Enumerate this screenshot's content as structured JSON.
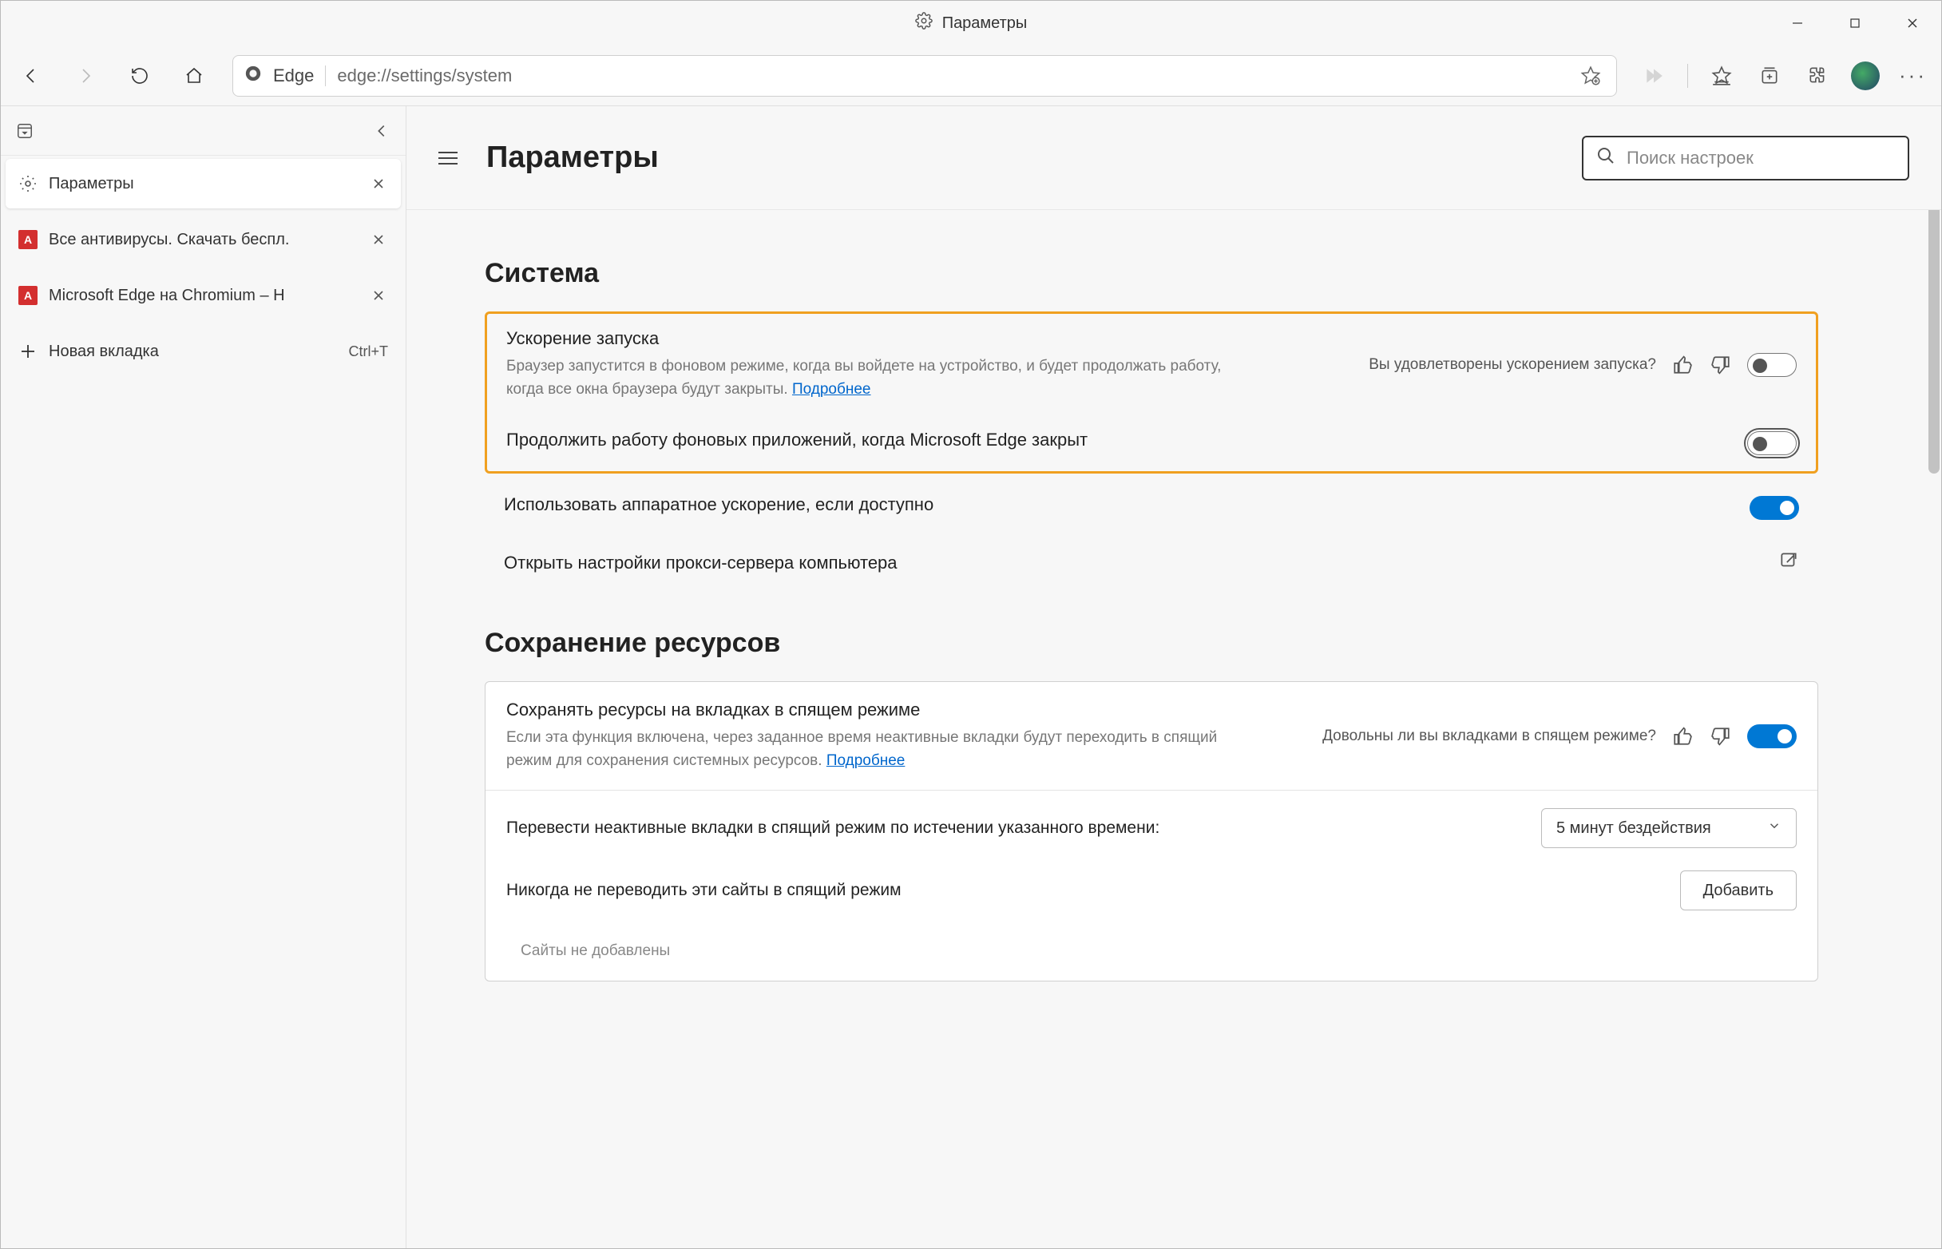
{
  "window": {
    "title": "Параметры"
  },
  "toolbar": {
    "edge_label": "Edge",
    "url": "edge://settings/system"
  },
  "vtabs": {
    "tabs": [
      {
        "label": "Параметры",
        "active": true,
        "close": true
      },
      {
        "label": "Все антивирусы. Скачать беспл.",
        "active": false,
        "close": true
      },
      {
        "label": "Microsoft Edge на Chromium – Н",
        "active": false,
        "close": true
      }
    ],
    "new_tab_label": "Новая вкладка",
    "new_tab_shortcut": "Ctrl+T"
  },
  "settings": {
    "page_title": "Параметры",
    "search_placeholder": "Поиск настроек",
    "section_system": "Система",
    "section_resources": "Сохранение ресурсов",
    "startup_boost": {
      "title": "Ускорение запуска",
      "desc_prefix": "Браузер запустится в фоновом режиме, когда вы войдете на устройство, и будет продолжать работу, когда все окна браузера будут закрыты. ",
      "learn_more": "Подробнее",
      "feedback_q": "Вы удовлетворены ускорением запуска?"
    },
    "bg_apps": {
      "title": "Продолжить работу фоновых приложений, когда Microsoft Edge закрыт"
    },
    "hw_accel": {
      "title": "Использовать аппаратное ускорение, если доступно"
    },
    "proxy": {
      "title": "Открыть настройки прокси-сервера компьютера"
    },
    "sleeping_tabs": {
      "title": "Сохранять ресурсы на вкладках в спящем режиме",
      "desc_prefix": "Если эта функция включена, через заданное время неактивные вкладки будут переходить в спящий режим для сохранения системных ресурсов. ",
      "learn_more": "Подробнее",
      "feedback_q": "Довольны ли вы вкладками в спящем режиме?"
    },
    "sleep_after": {
      "title": "Перевести неактивные вкладки в спящий режим по истечении указанного времени:",
      "selected": "5 минут бездействия"
    },
    "never_sleep": {
      "title": "Никогда не переводить эти сайты в спящий режим",
      "add_btn": "Добавить",
      "empty": "Сайты не добавлены"
    }
  }
}
